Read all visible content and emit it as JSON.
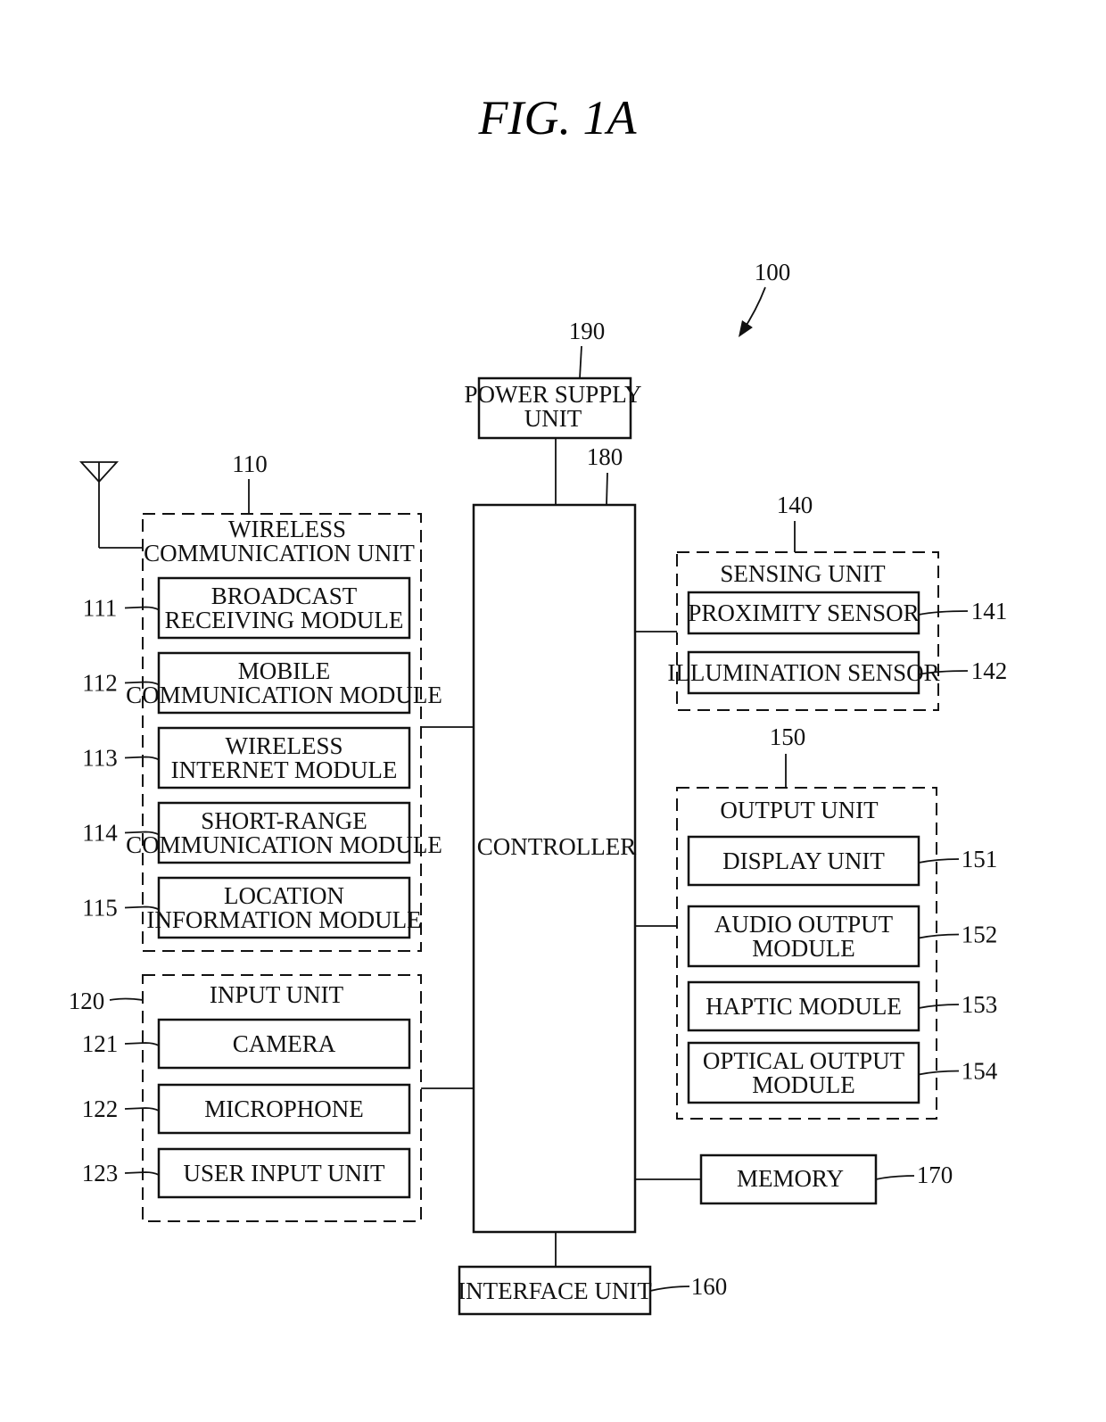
{
  "figure": {
    "title": "FIG. 1A",
    "device_ref": "100"
  },
  "power_supply": {
    "lines": [
      "POWER SUPPLY",
      "UNIT"
    ],
    "ref": "190"
  },
  "controller": {
    "label": "CONTROLLER",
    "ref": "180"
  },
  "wireless_unit": {
    "lines": [
      "WIRELESS",
      "COMMUNICATION UNIT"
    ],
    "ref": "110",
    "modules": [
      {
        "lines": [
          "BROADCAST",
          "RECEIVING MODULE"
        ],
        "ref": "111"
      },
      {
        "lines": [
          "MOBILE",
          "COMMUNICATION MODULE"
        ],
        "ref": "112"
      },
      {
        "lines": [
          "WIRELESS",
          "INTERNET MODULE"
        ],
        "ref": "113"
      },
      {
        "lines": [
          "SHORT-RANGE",
          "COMMUNICATION MODULE"
        ],
        "ref": "114"
      },
      {
        "lines": [
          "LOCATION",
          "INFORMATION MODULE"
        ],
        "ref": "115"
      }
    ]
  },
  "input_unit": {
    "label": "INPUT UNIT",
    "ref": "120",
    "modules": [
      {
        "label": "CAMERA",
        "ref": "121"
      },
      {
        "label": "MICROPHONE",
        "ref": "122"
      },
      {
        "label": "USER INPUT UNIT",
        "ref": "123"
      }
    ]
  },
  "sensing_unit": {
    "label": "SENSING UNIT",
    "ref": "140",
    "modules": [
      {
        "label": "PROXIMITY SENSOR",
        "ref": "141"
      },
      {
        "label": "ILLUMINATION SENSOR",
        "ref": "142"
      }
    ]
  },
  "output_unit": {
    "label": "OUTPUT UNIT",
    "ref": "150",
    "modules": [
      {
        "lines": [
          "DISPLAY UNIT"
        ],
        "ref": "151"
      },
      {
        "lines": [
          "AUDIO OUTPUT",
          "MODULE"
        ],
        "ref": "152"
      },
      {
        "lines": [
          "HAPTIC MODULE"
        ],
        "ref": "153"
      },
      {
        "lines": [
          "OPTICAL OUTPUT",
          "MODULE"
        ],
        "ref": "154"
      }
    ]
  },
  "memory": {
    "label": "MEMORY",
    "ref": "170"
  },
  "interface_unit": {
    "label": "INTERFACE UNIT",
    "ref": "160"
  }
}
